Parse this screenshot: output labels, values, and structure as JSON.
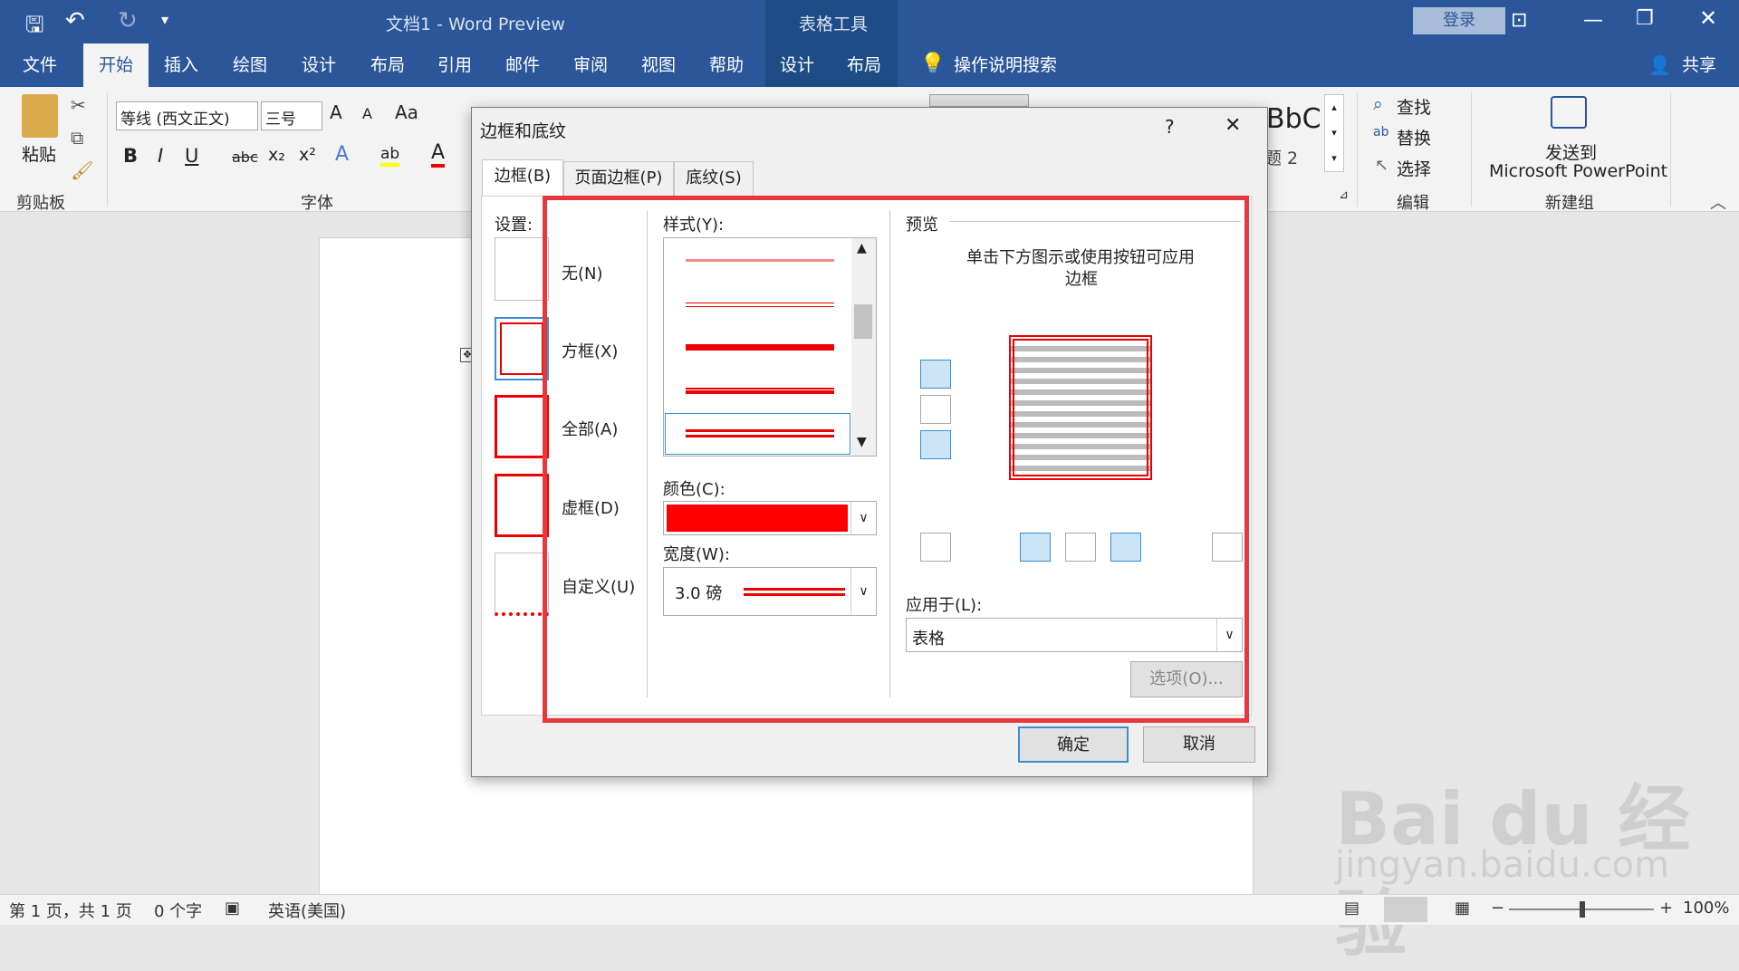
{
  "app": {
    "doc_title": "文档1 - Word Preview",
    "table_tools": "表格工具",
    "login": "登录",
    "share": "共享",
    "search_hint": "操作说明搜索"
  },
  "tabs": [
    "文件",
    "开始",
    "插入",
    "绘图",
    "设计",
    "布局",
    "引用",
    "邮件",
    "审阅",
    "视图",
    "帮助",
    "设计",
    "布局"
  ],
  "ribbon": {
    "paste": "粘贴",
    "clipboard": "剪贴板",
    "font_name": "等线 (西文正文)",
    "font_size": "三号",
    "font_group": "字体",
    "style_preview": "BbC",
    "style_name": "题 2",
    "find": "查找",
    "replace": "替换",
    "select": "选择",
    "edit_group": "编辑",
    "send_to": "发送到",
    "ppt": "Microsoft PowerPoint",
    "new_group": "新建组"
  },
  "dialog": {
    "title": "边框和底纹",
    "help": "?",
    "tabs": [
      "边框(B)",
      "页面边框(P)",
      "底纹(S)"
    ],
    "settings_label": "设置:",
    "settings": [
      "无(N)",
      "方框(X)",
      "全部(A)",
      "虚框(D)",
      "自定义(U)"
    ],
    "style_label": "样式(Y):",
    "color_label": "颜色(C):",
    "width_label": "宽度(W):",
    "width_value": "3.0 磅",
    "preview_label": "预览",
    "preview_hint_1": "单击下方图示或使用按钮可应用",
    "preview_hint_2": "边框",
    "apply_label": "应用于(L):",
    "apply_value": "表格",
    "options": "选项(O)...",
    "ok": "确定",
    "cancel": "取消",
    "accent": "#ff0000"
  },
  "status": {
    "page": "第 1 页，共 1 页",
    "words": "0 个字",
    "lang": "英语(美国)",
    "zoom": "100%"
  },
  "watermark": {
    "brand": "Bai du 经验",
    "url": "jingyan.baidu.com"
  }
}
